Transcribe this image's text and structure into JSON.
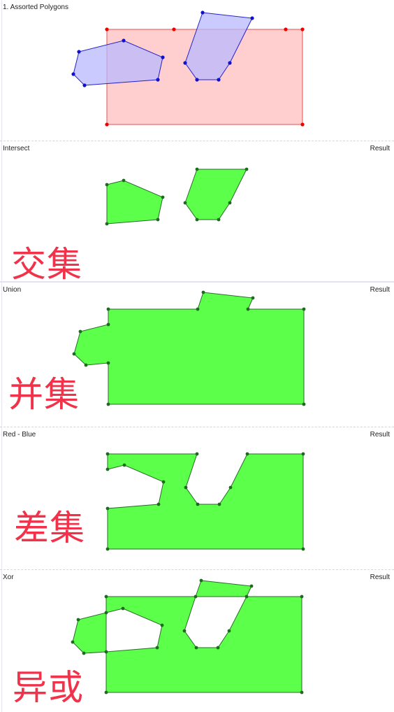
{
  "panels": [
    {
      "title": "1. Assorted Polygons",
      "result": "",
      "label_cn": ""
    },
    {
      "title": "Intersect",
      "result": "Result",
      "label_cn": "交集"
    },
    {
      "title": "Union",
      "result": "Result",
      "label_cn": "并集"
    },
    {
      "title": "Red - Blue",
      "result": "Result",
      "label_cn": "差集"
    },
    {
      "title": "Xor",
      "result": "Result",
      "label_cn": "异或"
    }
  ],
  "colors": {
    "subject_fill": "#ffcccc",
    "subject_stroke": "#e05050",
    "subject_vertex": "#ee0000",
    "clip_fill": "#c8c8ff",
    "clip_stroke": "#2222cc",
    "clip_vertex": "#1111cc",
    "result_fill": "#5cff4a",
    "result_stroke": "#2a6a2a",
    "result_vertex": "#1d6b1d",
    "label_red": "#f0334a"
  }
}
